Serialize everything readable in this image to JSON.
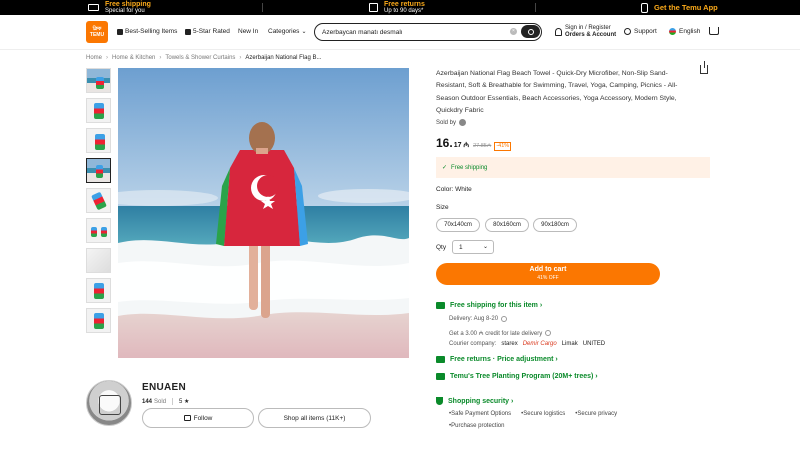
{
  "topbar": {
    "free_shipping_title": "Free shipping",
    "free_shipping_sub": "Special for you",
    "free_returns_title": "Free returns",
    "free_returns_sub": "Up to 90 days*",
    "app_label": "Get the Temu App"
  },
  "header": {
    "logo_text_1": "ক্লিক",
    "logo_text_2": "TEMU",
    "nav": [
      "Best-Selling Items",
      "5-Star Rated",
      "New In",
      "Categories"
    ],
    "search_value": "Azerbaycan manatı desmalı",
    "account_line1": "Sign in / Register",
    "account_line2": "Orders & Account",
    "support": "Support",
    "language": "English"
  },
  "breadcrumb": [
    "Home",
    "Home & Kitchen",
    "Towels & Shower Curtains",
    "Azerbaijan National Flag B..."
  ],
  "product": {
    "title": "Azerbaijan National Flag Beach Towel - Quick-Dry Microfiber, Non-Slip Sand-Resistant, Soft & Breathable for Swimming, Travel, Yoga, Camping, Picnics - All-Season Outdoor Essentials, Beach Accessories, Yoga Accessory, Modern Style, Quickdry Fabric",
    "sold_by": "Sold by",
    "price_main": "16.",
    "price_cents": "17 ₼",
    "price_old": "27.85₼",
    "discount": "-41%",
    "free_shipping": "Free shipping",
    "color_label": "Color:",
    "color_value": "White",
    "size_label": "Size",
    "sizes": [
      "70x140cm",
      "80x160cm",
      "90x180cm"
    ],
    "qty_label": "Qty",
    "qty_value": "1",
    "add_to_cart": "Add to cart",
    "add_to_cart_sub": "41% OFF"
  },
  "shipping": {
    "title": "Free shipping for this item",
    "delivery": "Delivery: Aug 8-20",
    "credit": "Get a 3.00 ₼ credit for late delivery",
    "courier_label": "Courier company:",
    "couriers": [
      "starex",
      "Demir Cargo",
      "Limak",
      "UNITED"
    ],
    "returns": "Free returns · Price adjustment",
    "tree": "Temu's Tree Planting Program (20M+ trees)",
    "security_title": "Shopping security",
    "security_items": [
      "Safe Payment Options",
      "Secure logistics",
      "Secure privacy",
      "Purchase protection"
    ]
  },
  "store": {
    "name": "ENUAEN",
    "sold_count": "144",
    "sold_label": "Sold",
    "rating": "5 ★",
    "follow": "Follow",
    "all_items": "Shop all items (11K+)"
  },
  "colors": {
    "accent": "#fb7701",
    "green": "#0a8a2a",
    "flag_blue": "#3ca0e6",
    "flag_red": "#d7263d",
    "flag_green": "#2aa34a"
  }
}
